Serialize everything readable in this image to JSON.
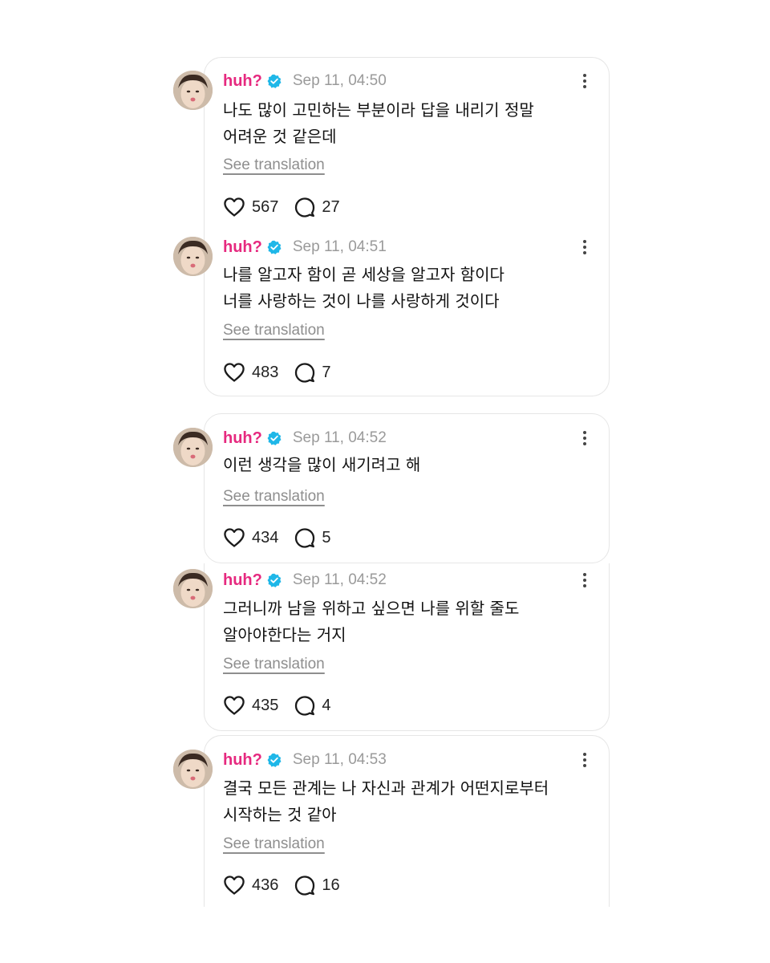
{
  "posts": [
    {
      "username": "huh?",
      "time": "Sep 11, 04:50",
      "text": "나도 많이 고민하는 부분이라 답을 내리기 정말\n어려운 것 같은데",
      "see_translation": "See translation",
      "likes": "567",
      "replies": "27"
    },
    {
      "username": "huh?",
      "time": "Sep 11, 04:51",
      "text": "나를 알고자 함이 곧 세상을 알고자 함이다\n너를 사랑하는 것이 나를 사랑하게 것이다",
      "see_translation": "See translation",
      "likes": "483",
      "replies": "7"
    },
    {
      "username": "huh?",
      "time": "Sep 11, 04:52",
      "text": "이런 생각을 많이 새기려고 해",
      "see_translation": "See translation",
      "likes": "434",
      "replies": "5"
    },
    {
      "username": "huh?",
      "time": "Sep 11, 04:52",
      "text": "그러니까 남을 위하고 싶으면 나를 위할 줄도\n알아야한다는 거지",
      "see_translation": "See translation",
      "likes": "435",
      "replies": "4"
    },
    {
      "username": "huh?",
      "time": "Sep 11, 04:53",
      "text": "결국 모든 관계는 나 자신과 관계가 어떤지로부터\n시작하는 것 같아",
      "see_translation": "See translation",
      "likes": "436",
      "replies": "16"
    }
  ],
  "icons": {
    "verified": "verified-badge-icon",
    "more": "more-options-icon",
    "like": "heart-icon",
    "reply": "comment-bubble-icon"
  },
  "colors": {
    "username": "#e6297f",
    "verified": "#1fb7e8",
    "meta": "#9a9a9a",
    "border": "#e6e6e6"
  }
}
